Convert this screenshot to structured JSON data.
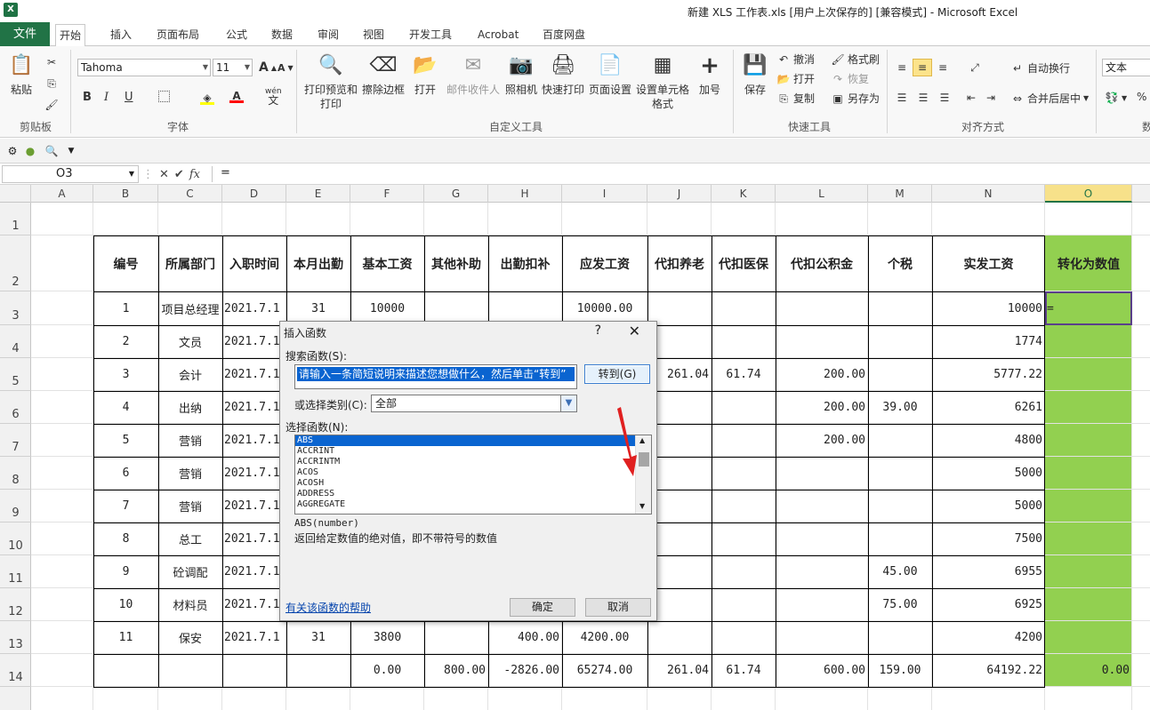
{
  "window": {
    "title": "新建 XLS 工作表.xls [用户上次保存的] [兼容模式] - Microsoft Excel"
  },
  "tabs": {
    "file": "文件",
    "home": "开始",
    "insert": "插入",
    "layout": "页面布局",
    "formulas": "公式",
    "data": "数据",
    "review": "审阅",
    "view": "视图",
    "developer": "开发工具",
    "acrobat": "Acrobat",
    "baidu": "百度网盘"
  },
  "ribbon": {
    "clipboard": {
      "paste": "粘贴",
      "label": "剪贴板"
    },
    "font": {
      "name": "Tahoma",
      "size": "11",
      "label": "字体",
      "grow": "A",
      "shrink": "A",
      "bold": "B",
      "italic": "I",
      "underline": "U",
      "wen": "wén",
      "wen_char": "文"
    },
    "custom": {
      "label": "自定义工具",
      "print_preview": "打印预览和打印",
      "erase_border": "擦除边框",
      "open": "打开",
      "mail": "邮件收件人",
      "camera": "照相机",
      "quick_print": "快速打印",
      "page_setup": "页面设置",
      "cell_format": "设置单元格格式",
      "plus": "加号"
    },
    "quick": {
      "label": "快速工具",
      "save": "保存",
      "undo": "撤消",
      "open": "打开",
      "copy": "复制",
      "format_painter": "格式刷",
      "redo": "恢复",
      "save_as": "另存为"
    },
    "align": {
      "label": "对齐方式",
      "wrap": "自动换行",
      "merge": "合并后居中"
    },
    "number": {
      "format": "文本",
      "label": "数",
      "percent": "%"
    }
  },
  "formula_bar": {
    "name_box": "O3",
    "fx": "fx",
    "value": "="
  },
  "columns": [
    "A",
    "B",
    "C",
    "D",
    "E",
    "F",
    "G",
    "H",
    "I",
    "J",
    "K",
    "L",
    "M",
    "N",
    "O"
  ],
  "rows": [
    "1",
    "2",
    "3",
    "4",
    "5",
    "6",
    "7",
    "8",
    "9",
    "10",
    "11",
    "12",
    "13",
    "14"
  ],
  "headers": {
    "B": "编号",
    "C": "所属部门",
    "D": "入职时间",
    "E": "本月出勤",
    "F": "基本工资",
    "G": "其他补助",
    "H": "出勤扣补",
    "I": "应发工资",
    "J": "代扣养老",
    "K": "代扣医保",
    "L": "代扣公积金",
    "M": "个税",
    "N": "实发工资",
    "O": "转化为数值"
  },
  "table_rows": [
    {
      "B": "1",
      "C": "项目总经理",
      "D": "2021.7.1",
      "E": "31",
      "F": "10000",
      "I": "10000.00",
      "N": "10000",
      "O": "="
    },
    {
      "B": "2",
      "C": "文员",
      "D": "2021.7.1",
      "N": "1774"
    },
    {
      "B": "3",
      "C": "会计",
      "D": "2021.7.1",
      "J": "261.04",
      "K": "61.74",
      "L": "200.00",
      "N": "5777.22"
    },
    {
      "B": "4",
      "C": "出纳",
      "D": "2021.7.1",
      "L": "200.00",
      "M": "39.00",
      "N": "6261"
    },
    {
      "B": "5",
      "C": "营销",
      "D": "2021.7.1",
      "L": "200.00",
      "N": "4800"
    },
    {
      "B": "6",
      "C": "营销",
      "D": "2021.7.1",
      "N": "5000"
    },
    {
      "B": "7",
      "C": "营销",
      "D": "2021.7.1",
      "N": "5000"
    },
    {
      "B": "8",
      "C": "总工",
      "D": "2021.7.1",
      "N": "7500"
    },
    {
      "B": "9",
      "C": "砼调配",
      "D": "2021.7.1",
      "M": "45.00",
      "N": "6955"
    },
    {
      "B": "10",
      "C": "材料员",
      "D": "2021.7.1",
      "M": "75.00",
      "N": "6925"
    },
    {
      "B": "11",
      "C": "保安",
      "D": "2021.7.1",
      "E": "31",
      "F": "3800",
      "H": "400.00",
      "I": "4200.00",
      "N": "4200"
    },
    {
      "F": "0.00",
      "G": "800.00",
      "H": "-2826.00",
      "I": "65274.00",
      "J": "261.04",
      "K": "61.74",
      "L": "600.00",
      "M": "159.00",
      "N": "64192.22",
      "O": "0.00"
    }
  ],
  "dialog": {
    "title": "插入函数",
    "help": "?",
    "close": "✕",
    "search_label": "搜索函数(S):",
    "search_value": "请输入一条简短说明来描述您想做什么，然后单击“转到”",
    "goto": "转到(G)",
    "category_label": "或选择类别(C):",
    "category_value": "全部",
    "list_label": "选择函数(N):",
    "functions": [
      "ABS",
      "ACCRINT",
      "ACCRINTM",
      "ACOS",
      "ACOSH",
      "ADDRESS",
      "AGGREGATE"
    ],
    "syntax": "ABS(number)",
    "description": "返回给定数值的绝对值，即不带符号的数值",
    "help_link": "有关该函数的帮助",
    "ok": "确定",
    "cancel": "取消"
  },
  "colors": {
    "accent": "#217346",
    "green_fill": "#92d050",
    "selection": "#0a64d0",
    "arrow": "#e02020"
  }
}
